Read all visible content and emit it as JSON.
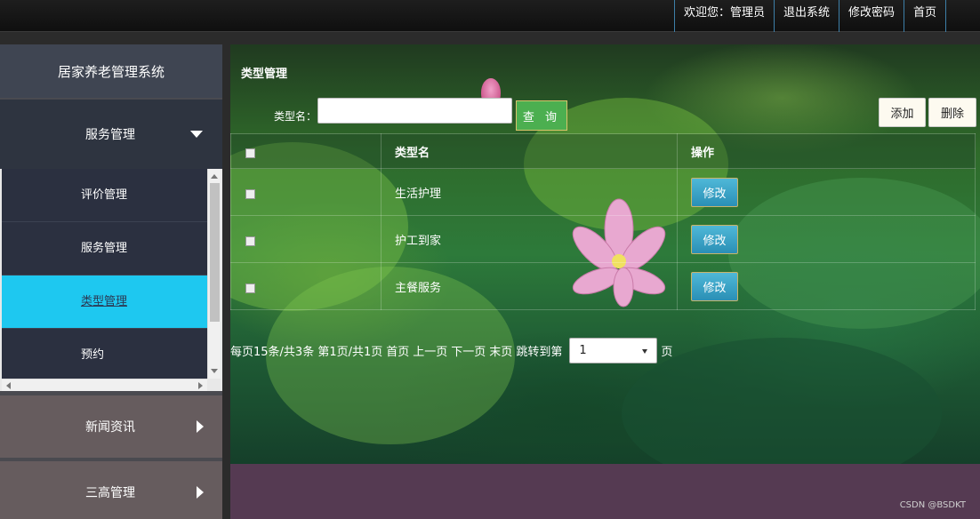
{
  "topnav": {
    "welcome": "欢迎您：管理员",
    "logout": "退出系统",
    "change_password": "修改密码",
    "home": "首页"
  },
  "sidebar": {
    "brand": "居家养老管理系统",
    "groups": [
      {
        "label": "服务管理",
        "expanded": true
      },
      {
        "label": "新闻资讯",
        "expanded": false
      },
      {
        "label": "三高管理",
        "expanded": false
      }
    ],
    "subitems": [
      {
        "label": "评价管理"
      },
      {
        "label": "服务管理"
      },
      {
        "label": "类型管理",
        "active": true
      },
      {
        "label": "预约"
      }
    ],
    "active_color": "#1ec8f0"
  },
  "main": {
    "title": "类型管理",
    "search_label": "类型名：",
    "search_value": "",
    "query_button": "查 询",
    "add_button": "添加",
    "delete_button": "删除",
    "table": {
      "headers": [
        "",
        "类型名",
        "操作"
      ],
      "rows": [
        {
          "name": "生活护理",
          "action": "修改"
        },
        {
          "name": "护工到家",
          "action": "修改"
        },
        {
          "name": "主餐服务",
          "action": "修改"
        }
      ]
    },
    "pager": {
      "summary": "每页15条/共3条 第1页/共1页",
      "first": "首页",
      "prev": "上一页",
      "next": "下一页",
      "last": "末页",
      "jump_label": "跳转到第",
      "jump_value": "1",
      "suffix": "页"
    }
  },
  "watermark": "CSDN @BSDKT"
}
